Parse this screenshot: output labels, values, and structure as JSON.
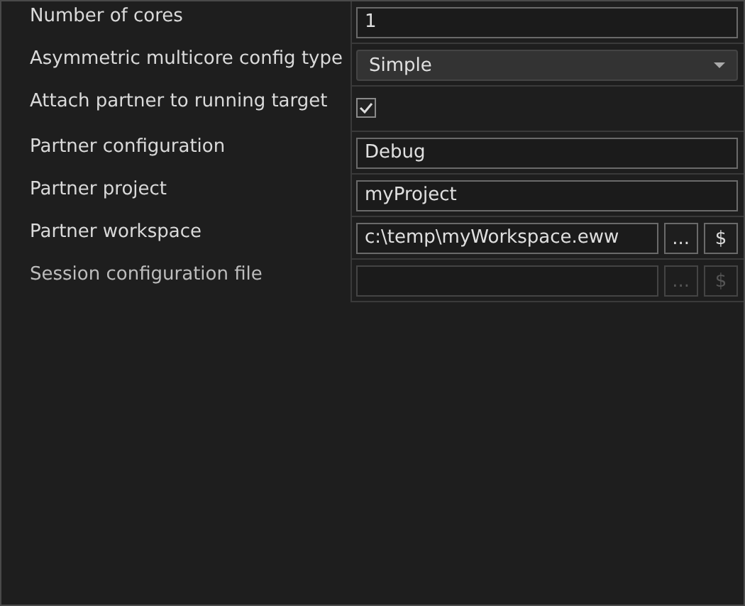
{
  "properties": [
    {
      "kind": "text",
      "label": "Number of cores",
      "value": "1",
      "disabled": false
    },
    {
      "kind": "dropdown",
      "label": "Asymmetric multicore config type",
      "value": "Simple"
    },
    {
      "kind": "checkbox",
      "label": "Attach partner to running target",
      "checked": true
    },
    {
      "kind": "text",
      "label": "Partner configuration",
      "value": "Debug",
      "disabled": false
    },
    {
      "kind": "text",
      "label": "Partner project",
      "value": "myProject",
      "disabled": false
    },
    {
      "kind": "path",
      "label": "Partner workspace",
      "value": "c:\\temp\\myWorkspace.eww",
      "browse": "...",
      "macro": "$",
      "disabled": false
    },
    {
      "kind": "path",
      "label": "Session configuration file",
      "browse": "...",
      "macro": "$",
      "disabled": true
    }
  ]
}
